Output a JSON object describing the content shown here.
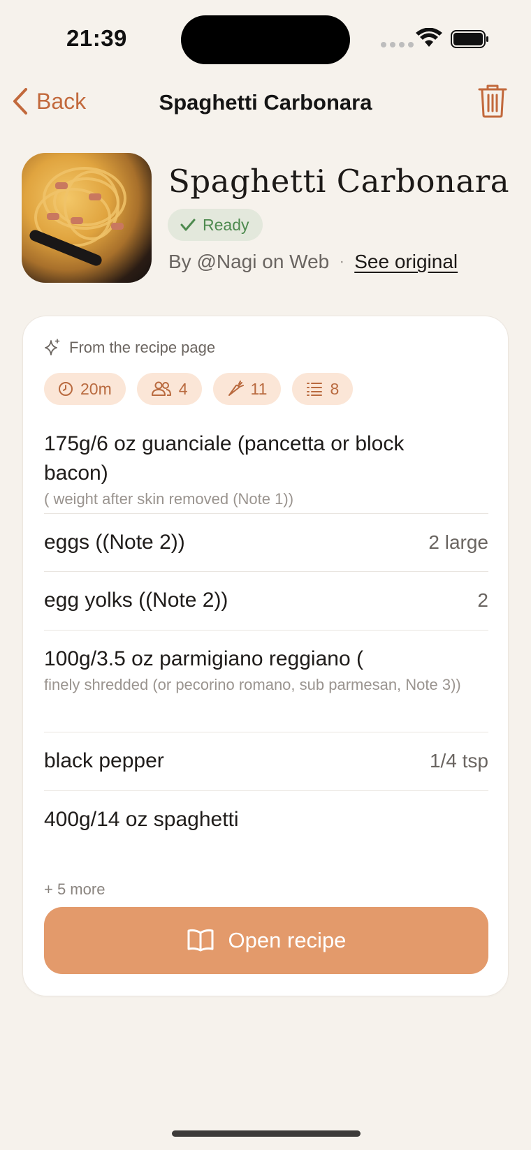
{
  "status_bar": {
    "time": "21:39"
  },
  "nav": {
    "back_label": "Back",
    "title": "Spaghetti Carbonara"
  },
  "recipe": {
    "title": "Spaghetti Carbonara",
    "status": "Ready",
    "byline": "By @Nagi on Web",
    "separator": "·",
    "see_original": "See original"
  },
  "card": {
    "source_label": "From the recipe page",
    "stats": {
      "time": "20m",
      "servings": "4",
      "ingredients": "11",
      "steps": "8"
    },
    "ingredients": [
      {
        "name": "175g/6 oz guanciale (pancetta or block bacon)",
        "note": "( weight after skin removed (Note 1))",
        "qty": ""
      },
      {
        "name": "eggs ((Note 2))",
        "note": "",
        "qty": "2 large"
      },
      {
        "name": "egg yolks ((Note 2))",
        "note": "",
        "qty": "2"
      },
      {
        "name": "100g/3.5 oz parmigiano reggiano (",
        "note": "finely shredded (or pecorino romano, sub parmesan, Note 3))",
        "qty": ""
      },
      {
        "name": "black pepper",
        "note": "",
        "qty": "1/4 tsp"
      },
      {
        "name": "400g/14 oz spaghetti",
        "note": "",
        "qty": ""
      }
    ],
    "more_label": "+ 5 more",
    "open_button_label": "Open recipe"
  },
  "colors": {
    "accent": "#c2693c",
    "button": "#e39a6b",
    "chip_bg": "#fbe6d7",
    "ready_bg": "#e3e8dc",
    "ready_text": "#4e8a4f",
    "background": "#f6f2ec"
  },
  "icons": {
    "back": "chevron-left-icon",
    "trash": "trash-icon",
    "sparkle": "sparkle-icon",
    "time": "clock-icon",
    "servings": "people-icon",
    "ingredients": "carrot-icon",
    "steps": "list-icon",
    "open": "book-icon",
    "ready": "checkmark-icon"
  }
}
